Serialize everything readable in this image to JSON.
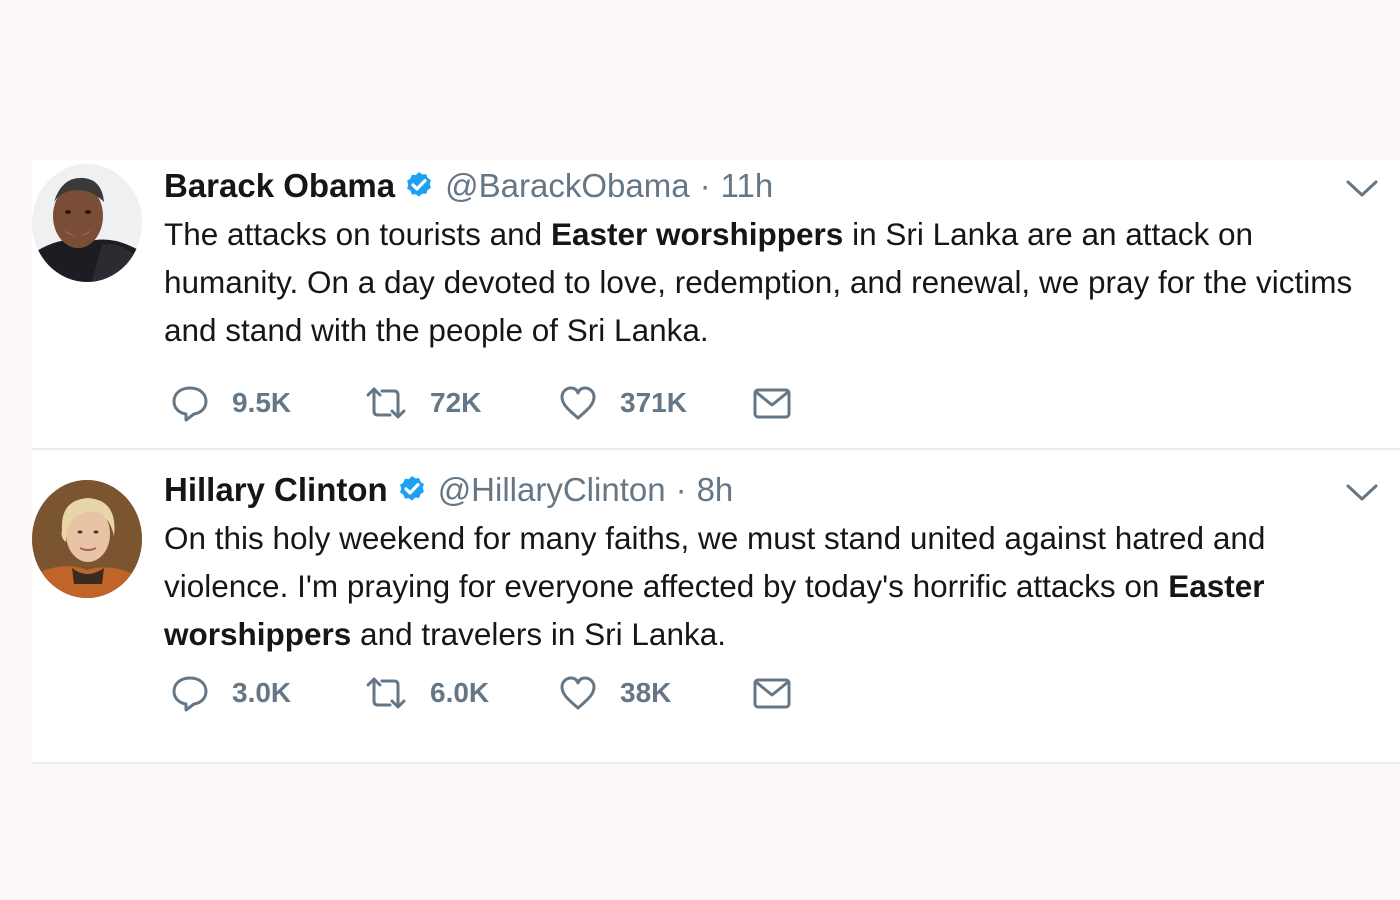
{
  "tweets": [
    {
      "name": "Barack Obama",
      "handle": "@BarackObama",
      "separator": "·",
      "time": "11h",
      "text_parts": [
        {
          "text": "The attacks on tourists and ",
          "bold": false
        },
        {
          "text": "Easter worshippers",
          "bold": true
        },
        {
          "text": " in Sri Lanka are an attack on humanity. On a day devoted to love, redemption, and renewal, we pray for the victims and stand with the people of Sri Lanka.",
          "bold": false
        }
      ],
      "replies": "9.5K",
      "retweets": "72K",
      "likes": "371K"
    },
    {
      "name": "Hillary Clinton",
      "handle": "@HillaryClinton",
      "separator": "·",
      "time": "8h",
      "text_parts": [
        {
          "text": "On this holy weekend for many faiths, we must stand united against hatred and violence. I'm praying for everyone affected by today's horrific attacks on ",
          "bold": false
        },
        {
          "text": "Easter worshippers",
          "bold": true
        },
        {
          "text": " and travelers in Sri Lanka.",
          "bold": false
        }
      ],
      "replies": "3.0K",
      "retweets": "6.0K",
      "likes": "38K"
    }
  ],
  "icons": {
    "verified": "verified-badge-icon",
    "caret": "chevron-down-icon",
    "reply": "reply-icon",
    "retweet": "retweet-icon",
    "like": "heart-icon",
    "dm": "envelope-icon"
  },
  "colors": {
    "verified_blue": "#1da1f2",
    "text": "#14171a",
    "muted": "#657786",
    "divider": "#e6ecf0"
  }
}
